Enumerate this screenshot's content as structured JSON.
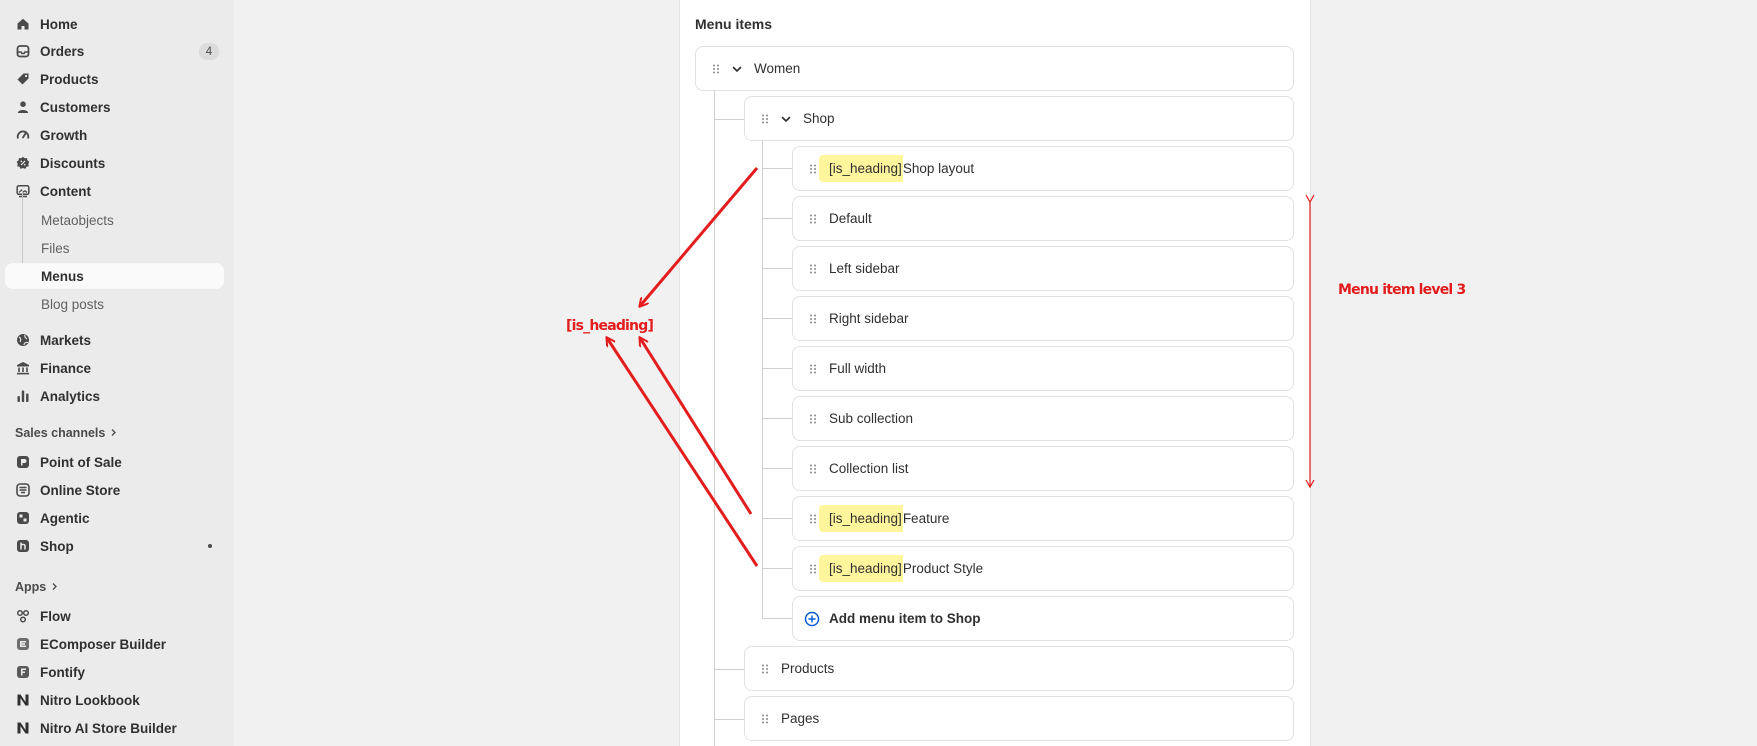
{
  "sidebar": {
    "items": [
      {
        "label": "Home",
        "icon": "home-icon"
      },
      {
        "label": "Orders",
        "icon": "inbox-icon",
        "badge": "4"
      },
      {
        "label": "Products",
        "icon": "tag-icon"
      },
      {
        "label": "Customers",
        "icon": "person-icon"
      },
      {
        "label": "Growth",
        "icon": "gauge-icon"
      },
      {
        "label": "Discounts",
        "icon": "discount-icon"
      },
      {
        "label": "Content",
        "icon": "content-icon"
      }
    ],
    "content_sub": [
      "Metaobjects",
      "Files",
      "Menus",
      "Blog posts"
    ],
    "items2": [
      {
        "label": "Markets",
        "icon": "globe-icon"
      },
      {
        "label": "Finance",
        "icon": "bank-icon"
      },
      {
        "label": "Analytics",
        "icon": "bar-chart-icon"
      }
    ],
    "sales_channels_label": "Sales channels",
    "channels": [
      {
        "label": "Point of Sale",
        "icon": "pos-icon"
      },
      {
        "label": "Online Store",
        "icon": "store-icon"
      },
      {
        "label": "Agentic",
        "icon": "agentic-icon"
      },
      {
        "label": "Shop",
        "icon": "shop-app-icon"
      }
    ],
    "apps_label": "Apps",
    "apps": [
      {
        "label": "Flow",
        "icon": "flow-icon"
      },
      {
        "label": "EComposer Builder",
        "icon": "ecomposer-icon"
      },
      {
        "label": "Fontify",
        "icon": "fontify-icon"
      },
      {
        "label": "Nitro Lookbook",
        "icon": "nitro-lookbook-icon"
      },
      {
        "label": "Nitro AI Store Builder",
        "icon": "nitro-builder-icon"
      }
    ]
  },
  "menu": {
    "title": "Menu items",
    "level1": "Women",
    "level2": "Shop",
    "heading_tag": "[is_heading]",
    "level3": [
      {
        "label": "Shop layout",
        "heading": true
      },
      {
        "label": "Default",
        "heading": false
      },
      {
        "label": "Left sidebar",
        "heading": false
      },
      {
        "label": "Right sidebar",
        "heading": false
      },
      {
        "label": "Full width",
        "heading": false
      },
      {
        "label": "Sub collection",
        "heading": false
      },
      {
        "label": "Collection list",
        "heading": false
      },
      {
        "label": "Feature",
        "heading": true
      },
      {
        "label": "Product Style",
        "heading": true
      }
    ],
    "add_label": "Add menu item to Shop",
    "level2_more": [
      "Products",
      "Pages"
    ]
  },
  "annotations": {
    "heading_label": "[is_heading]",
    "level3_label": "Menu item level 3",
    "color": "#e31d1d"
  }
}
